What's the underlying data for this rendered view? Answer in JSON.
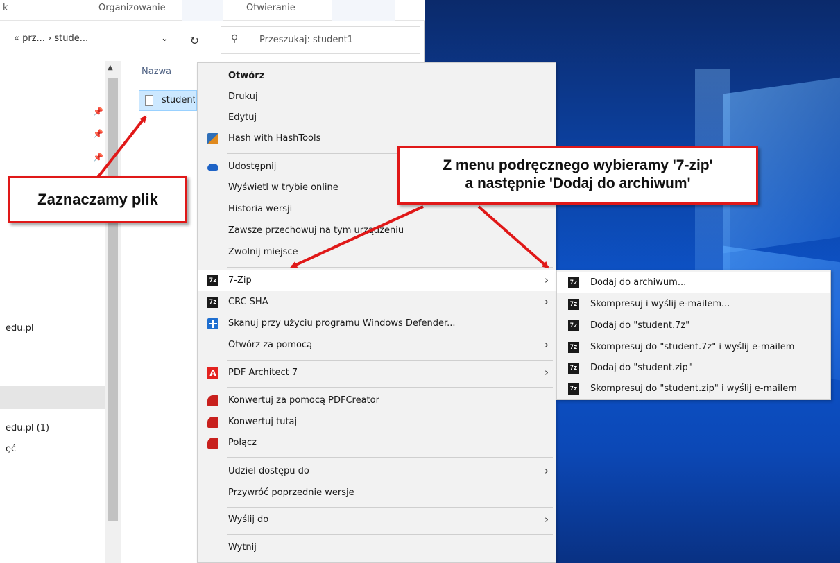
{
  "ribbon": {
    "left_fragment": "k",
    "group1": "Organizowanie",
    "group2": "Otwieranie"
  },
  "address": {
    "path": "« prz... › stude...",
    "dropdown_glyph": "⌄",
    "refresh_glyph": "↻"
  },
  "search": {
    "placeholder": "Przeszukaj: student1",
    "icon": "search-icon"
  },
  "navpane": {
    "items": [
      "edu.pl",
      "edu.pl (1)",
      "ęć"
    ],
    "pin_icon": "pin-icon"
  },
  "file_list": {
    "column_header": "Nazwa",
    "selected_file": "student"
  },
  "context_menu": {
    "items": [
      {
        "label": "Otwórz",
        "bold": true
      },
      {
        "label": "Drukuj"
      },
      {
        "label": "Edytuj"
      },
      {
        "label": "Hash with HashTools",
        "icon": "hashtools-icon"
      },
      {
        "label": "Udostępnij",
        "icon": "onedrive-cloud-icon"
      },
      {
        "label": "Wyświetl w trybie online"
      },
      {
        "label": "Historia wersji"
      },
      {
        "label": "Zawsze przechowuj na tym urządzeniu"
      },
      {
        "label": "Zwolnij miejsce"
      },
      {
        "label": "7-Zip",
        "icon": "7zip-icon",
        "submenu": true,
        "highlighted": true
      },
      {
        "label": "CRC SHA",
        "icon": "7zip-icon",
        "submenu": true
      },
      {
        "label": "Skanuj przy użyciu programu Windows Defender...",
        "icon": "windows-defender-icon"
      },
      {
        "label": "Otwórz za pomocą",
        "submenu": true
      },
      {
        "label": "PDF Architect 7",
        "icon": "pdf-architect-icon",
        "submenu": true
      },
      {
        "label": "Konwertuj za pomocą PDFCreator",
        "icon": "pdfcreator-icon"
      },
      {
        "label": "Konwertuj tutaj",
        "icon": "pdfcreator-icon"
      },
      {
        "label": "Połącz",
        "icon": "pdfcreator-icon"
      },
      {
        "label": "Udziel dostępu do",
        "submenu": true
      },
      {
        "label": "Przywróć poprzednie wersje"
      },
      {
        "label": "Wyślij do",
        "submenu": true
      },
      {
        "label": "Wytnij"
      }
    ],
    "submenu_arrow": "›"
  },
  "zip_submenu": {
    "items": [
      {
        "label": "Dodaj do archiwum...",
        "highlighted": true
      },
      {
        "label": "Skompresuj i wyślij e-mailem..."
      },
      {
        "label": "Dodaj do \"student.7z\""
      },
      {
        "label": "Skompresuj do \"student.7z\" i wyślij e-mailem"
      },
      {
        "label": "Dodaj do \"student.zip\""
      },
      {
        "label": "Skompresuj do \"student.zip\" i wyślij e-mailem"
      }
    ],
    "icon_text": "7z"
  },
  "annotations": {
    "callout1": "Zaznaczamy plik",
    "callout2_line1": "Z menu podręcznego wybieramy '7-zip'",
    "callout2_line2": "a następnie 'Dodaj do archiwum'",
    "arrow_color": "#e01818"
  },
  "colors": {
    "accent_selection": "#cce8ff",
    "desktop_blue": "#0d56cf",
    "callout_border": "#e01818"
  }
}
